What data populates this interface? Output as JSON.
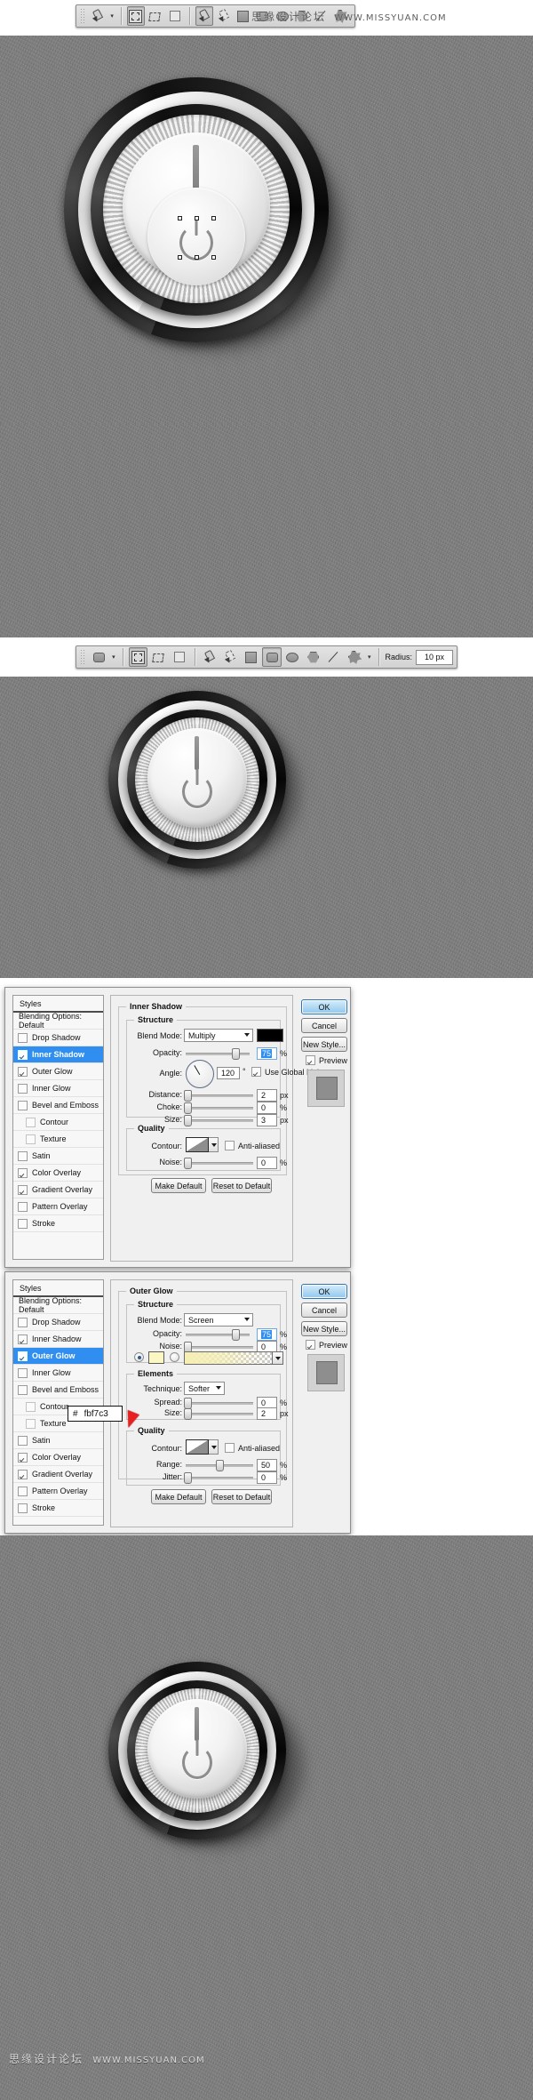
{
  "watermark": {
    "top_cn": "思缘设计论坛",
    "top_url": "WWW.MISSYUAN.COM",
    "bottom_cn": "思缘设计论坛",
    "bottom_url": "WWW.MISSYUAN.COM"
  },
  "toolbar_top": {
    "tool_preset_label": "pen-tool-preset",
    "dropdown_arrow": "▾",
    "buttons": [
      {
        "name": "shape-layers-button",
        "glyph": "shape-layers-icon",
        "active": true
      },
      {
        "name": "paths-button",
        "glyph": "paths-icon",
        "active": false
      },
      {
        "name": "fill-pixels-button",
        "glyph": "fill-pixels-icon",
        "active": false
      },
      {
        "name": "pen-tool-button",
        "glyph": "pen-icon",
        "active": true
      },
      {
        "name": "freeform-pen-button",
        "glyph": "freeform-pen-icon",
        "active": false
      },
      {
        "name": "rectangle-tool-button",
        "glyph": "rectangle-icon",
        "active": false
      },
      {
        "name": "rounded-rectangle-tool-button",
        "glyph": "rounded-rect-icon",
        "active": false
      },
      {
        "name": "ellipse-tool-button",
        "glyph": "ellipse-icon",
        "active": false
      },
      {
        "name": "polygon-tool-button",
        "glyph": "polygon-icon",
        "active": false
      },
      {
        "name": "line-tool-button",
        "glyph": "line-icon",
        "active": false
      },
      {
        "name": "custom-shape-tool-button",
        "glyph": "custom-shape-icon",
        "active": false
      }
    ]
  },
  "toolbar_second": {
    "tool_preset_label": "rounded-rectangle-preset",
    "dropdown_arrow": "▾",
    "radius_label": "Radius:",
    "radius_value": "10 px",
    "buttons": [
      {
        "name": "shape-layers-button",
        "glyph": "shape-layers-icon",
        "active": true
      },
      {
        "name": "paths-button",
        "glyph": "paths-icon",
        "active": false
      },
      {
        "name": "fill-pixels-button",
        "glyph": "fill-pixels-icon",
        "active": false
      },
      {
        "name": "pen-tool-button",
        "glyph": "pen-icon",
        "active": false
      },
      {
        "name": "freeform-pen-button",
        "glyph": "freeform-pen-icon",
        "active": false
      },
      {
        "name": "rectangle-tool-button",
        "glyph": "rectangle-icon",
        "active": false
      },
      {
        "name": "rounded-rectangle-tool-button",
        "glyph": "rounded-rect-icon",
        "active": true
      },
      {
        "name": "ellipse-tool-button",
        "glyph": "ellipse-icon",
        "active": false
      },
      {
        "name": "polygon-tool-button",
        "glyph": "polygon-icon",
        "active": false
      },
      {
        "name": "line-tool-button",
        "glyph": "line-icon",
        "active": false
      },
      {
        "name": "custom-shape-tool-button",
        "glyph": "custom-shape-icon",
        "active": false
      }
    ]
  },
  "styles_panel": {
    "title": "Styles",
    "blending_options": "Blending Options: Default",
    "items": [
      {
        "label": "Drop Shadow",
        "checked": false,
        "selected": false,
        "sub": false
      },
      {
        "label": "Inner Shadow",
        "checked": true,
        "selected": true,
        "sub": false
      },
      {
        "label": "Outer Glow",
        "checked": true,
        "selected": false,
        "sub": false
      },
      {
        "label": "Inner Glow",
        "checked": false,
        "selected": false,
        "sub": false
      },
      {
        "label": "Bevel and Emboss",
        "checked": false,
        "selected": false,
        "sub": false
      },
      {
        "label": "Contour",
        "checked": false,
        "selected": false,
        "sub": true
      },
      {
        "label": "Texture",
        "checked": false,
        "selected": false,
        "sub": true
      },
      {
        "label": "Satin",
        "checked": false,
        "selected": false,
        "sub": false
      },
      {
        "label": "Color Overlay",
        "checked": true,
        "selected": false,
        "sub": false
      },
      {
        "label": "Gradient Overlay",
        "checked": true,
        "selected": false,
        "sub": false
      },
      {
        "label": "Pattern Overlay",
        "checked": false,
        "selected": false,
        "sub": false
      },
      {
        "label": "Stroke",
        "checked": false,
        "selected": false,
        "sub": false
      }
    ]
  },
  "styles_panel_2": {
    "title": "Styles",
    "blending_options": "Blending Options: Default",
    "items": [
      {
        "label": "Drop Shadow",
        "checked": false,
        "selected": false,
        "sub": false
      },
      {
        "label": "Inner Shadow",
        "checked": true,
        "selected": false,
        "sub": false
      },
      {
        "label": "Outer Glow",
        "checked": true,
        "selected": true,
        "sub": false
      },
      {
        "label": "Inner Glow",
        "checked": false,
        "selected": false,
        "sub": false
      },
      {
        "label": "Bevel and Emboss",
        "checked": false,
        "selected": false,
        "sub": false
      },
      {
        "label": "Contour",
        "checked": false,
        "selected": false,
        "sub": true
      },
      {
        "label": "Texture",
        "checked": false,
        "selected": false,
        "sub": true
      },
      {
        "label": "Satin",
        "checked": false,
        "selected": false,
        "sub": false
      },
      {
        "label": "Color Overlay",
        "checked": true,
        "selected": false,
        "sub": false
      },
      {
        "label": "Gradient Overlay",
        "checked": true,
        "selected": false,
        "sub": false
      },
      {
        "label": "Pattern Overlay",
        "checked": false,
        "selected": false,
        "sub": false
      },
      {
        "label": "Stroke",
        "checked": false,
        "selected": false,
        "sub": false
      }
    ]
  },
  "buttons": {
    "ok": "OK",
    "cancel": "Cancel",
    "new_style": "New Style...",
    "preview": "Preview",
    "make_default": "Make Default",
    "reset_to_default": "Reset to Default"
  },
  "inner_shadow": {
    "group_title": "Inner Shadow",
    "structure_title": "Structure",
    "blend_mode_label": "Blend Mode:",
    "blend_mode_value": "Multiply",
    "blend_color": "#000000",
    "opacity_label": "Opacity:",
    "opacity_value": "75",
    "opacity_unit": "%",
    "angle_label": "Angle:",
    "angle_value": "120",
    "angle_unit": "°",
    "use_global_light": "Use Global Light",
    "use_global_light_checked": true,
    "distance_label": "Distance:",
    "distance_value": "2",
    "distance_unit": "px",
    "choke_label": "Choke:",
    "choke_value": "0",
    "choke_unit": "%",
    "size_label": "Size:",
    "size_value": "3",
    "size_unit": "px",
    "quality_title": "Quality",
    "contour_label": "Contour:",
    "anti_aliased": "Anti-aliased",
    "anti_aliased_checked": false,
    "noise_label": "Noise:",
    "noise_value": "0",
    "noise_unit": "%"
  },
  "outer_glow": {
    "group_title": "Outer Glow",
    "structure_title": "Structure",
    "blend_mode_label": "Blend Mode:",
    "blend_mode_value": "Screen",
    "opacity_label": "Opacity:",
    "opacity_value": "75",
    "opacity_unit": "%",
    "noise_label": "Noise:",
    "noise_value": "0",
    "noise_unit": "%",
    "glow_color": "#fbf7c3",
    "elements_title": "Elements",
    "technique_label": "Technique:",
    "technique_value": "Softer",
    "spread_label": "Spread:",
    "spread_value": "0",
    "spread_unit": "%",
    "size_label": "Size:",
    "size_value": "2",
    "size_unit": "px",
    "quality_title": "Quality",
    "contour_label": "Contour:",
    "anti_aliased": "Anti-aliased",
    "anti_aliased_checked": false,
    "range_label": "Range:",
    "range_value": "50",
    "range_unit": "%",
    "jitter_label": "Jitter:",
    "jitter_value": "0",
    "jitter_unit": "%"
  },
  "color_tooltip": {
    "hash": "#",
    "value": "fbf7c3"
  }
}
